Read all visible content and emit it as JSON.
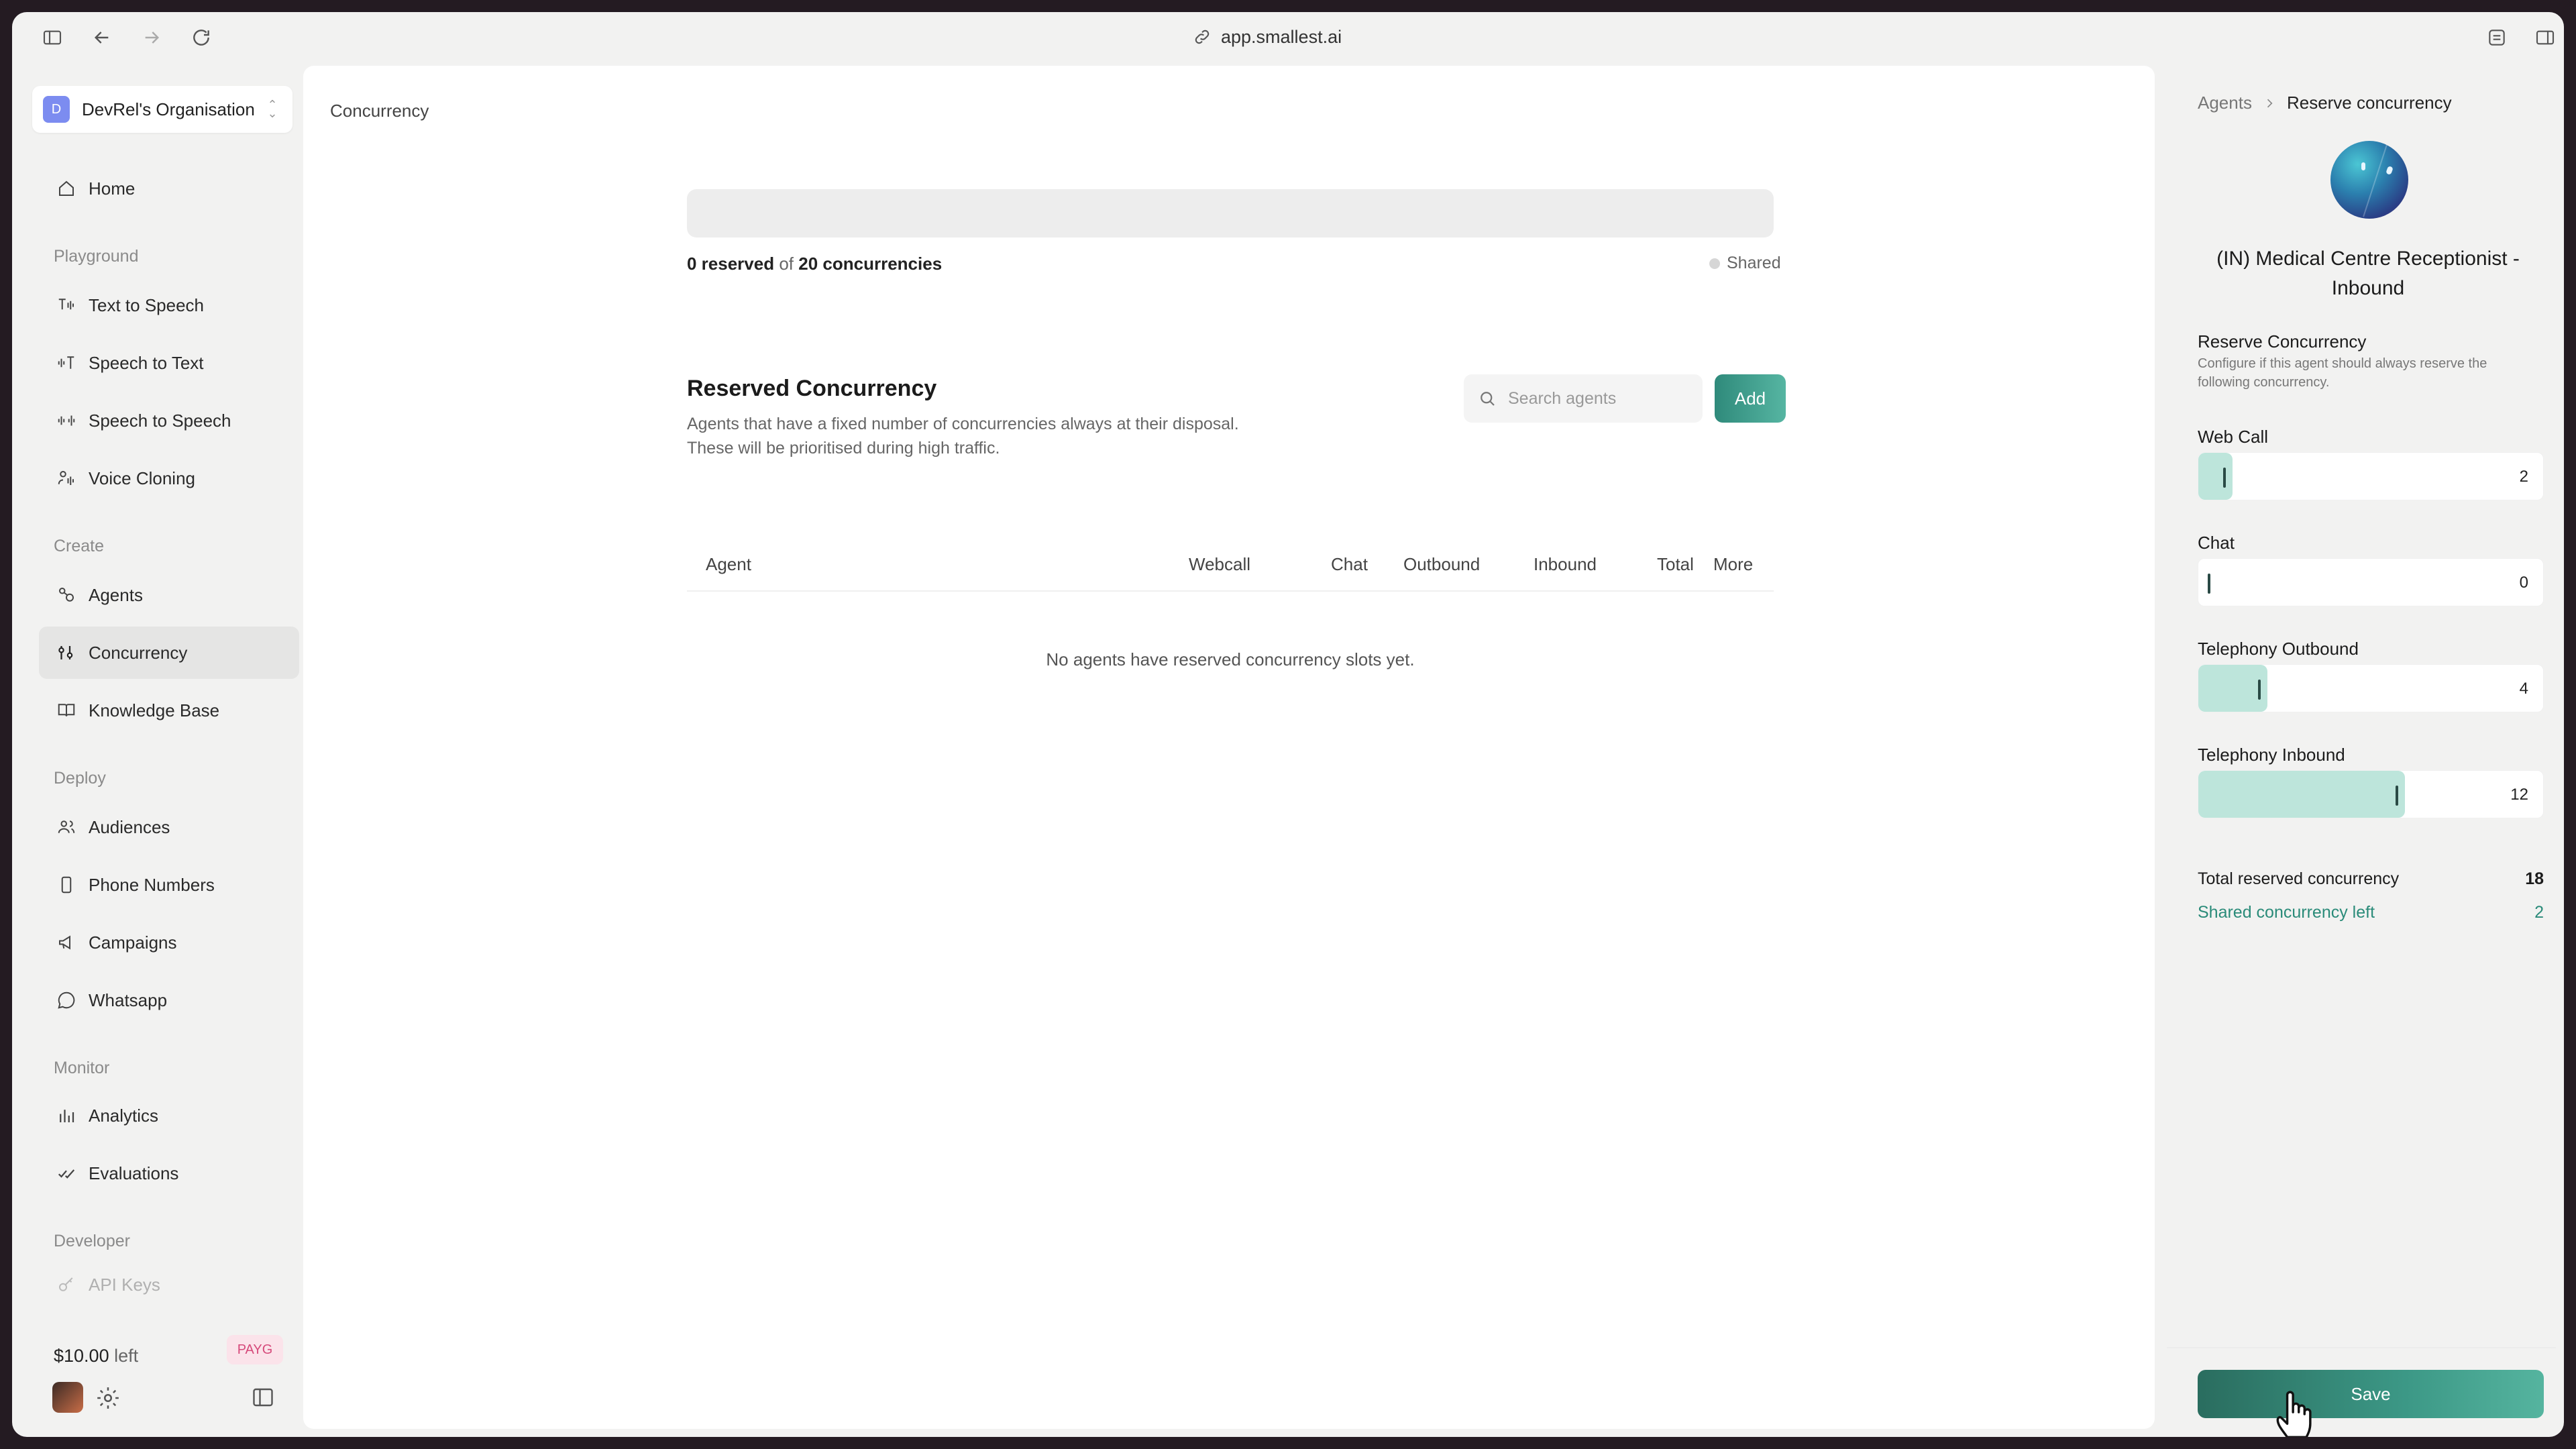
{
  "browser": {
    "url": "app.smallest.ai"
  },
  "sidebar": {
    "org": {
      "initial": "D",
      "name": "DevRel's Organisation"
    },
    "home": "Home",
    "sections": {
      "playground": "Playground",
      "create": "Create",
      "deploy": "Deploy",
      "monitor": "Monitor",
      "developer": "Developer"
    },
    "items": {
      "tts": "Text to Speech",
      "stt": "Speech to Text",
      "sts": "Speech to Speech",
      "cloning": "Voice Cloning",
      "agents": "Agents",
      "concurrency": "Concurrency",
      "kb": "Knowledge Base",
      "audiences": "Audiences",
      "phone": "Phone Numbers",
      "campaigns": "Campaigns",
      "whatsapp": "Whatsapp",
      "analytics": "Analytics",
      "evaluations": "Evaluations",
      "api_keys": "API Keys"
    },
    "credit_amount": "$10.00",
    "credit_suffix": "left",
    "plan_badge": "PAYG"
  },
  "main": {
    "breadcrumb": "Concurrency",
    "usage": {
      "reserved": "0 reserved",
      "of": "of",
      "total": "20 concurrencies",
      "legend_shared": "Shared"
    },
    "reserved_title": "Reserved Concurrency",
    "reserved_desc_1": "Agents that have a fixed number of concurrencies always at their disposal.",
    "reserved_desc_2": "These will be prioritised during high traffic.",
    "search_placeholder": "Search agents",
    "add_label": "Add",
    "table_headers": {
      "agent": "Agent",
      "webcall": "Webcall",
      "chat": "Chat",
      "outbound": "Outbound",
      "inbound": "Inbound",
      "total": "Total",
      "more": "More"
    },
    "empty_message": "No agents have reserved concurrency slots yet."
  },
  "panel": {
    "breadcrumb_parent": "Agents",
    "breadcrumb_current": "Reserve concurrency",
    "agent_name": "(IN) Medical Centre Receptionist - Inbound",
    "section_title": "Reserve Concurrency",
    "section_desc": "Configure if this agent should always reserve the following concurrency.",
    "sliders": {
      "web_call": {
        "label": "Web Call",
        "value": "2",
        "fraction": 0.1
      },
      "chat": {
        "label": "Chat",
        "value": "0",
        "fraction": 0.0
      },
      "outbound": {
        "label": "Telephony Outbound",
        "value": "4",
        "fraction": 0.2
      },
      "inbound": {
        "label": "Telephony Inbound",
        "value": "12",
        "fraction": 0.6
      }
    },
    "total_label": "Total reserved concurrency",
    "total_value": "18",
    "shared_label": "Shared concurrency left",
    "shared_value": "2",
    "save_label": "Save"
  },
  "colors": {
    "accent": "#2f8a7b",
    "slider_fill": "#bde5db",
    "badge_bg": "#fbe3ea",
    "badge_text": "#d64a7b"
  }
}
